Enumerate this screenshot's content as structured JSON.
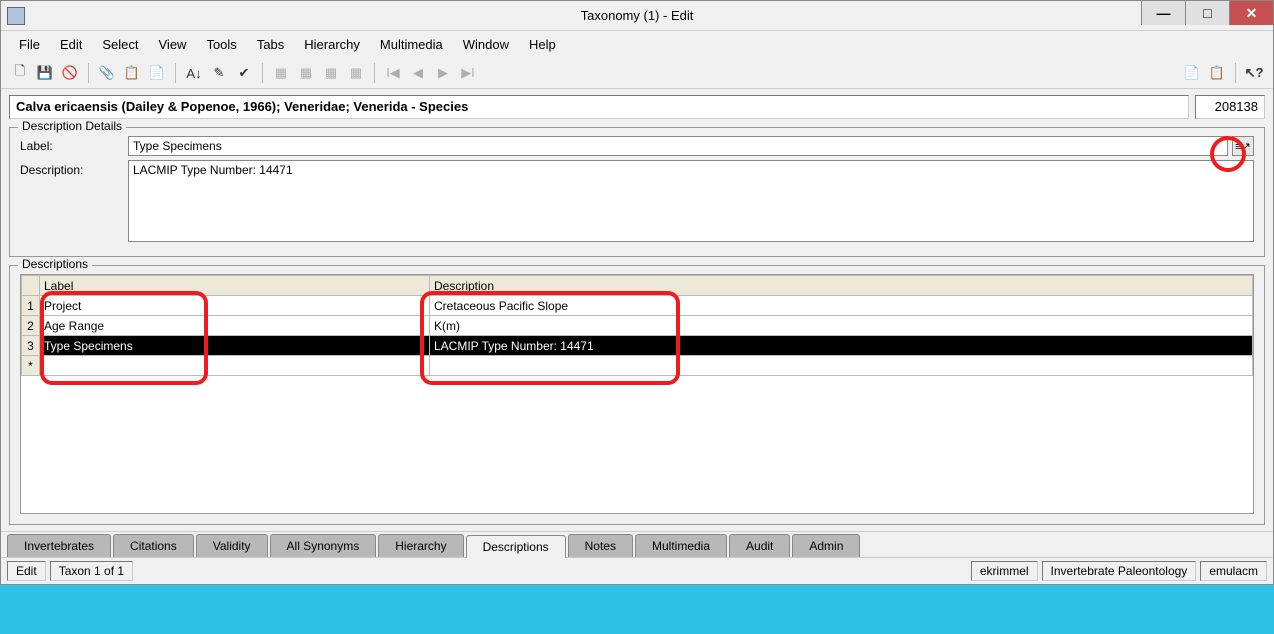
{
  "window": {
    "title": "Taxonomy (1) - Edit"
  },
  "menu": {
    "file": "File",
    "edit": "Edit",
    "select": "Select",
    "view": "View",
    "tools": "Tools",
    "tabs": "Tabs",
    "hierarchy": "Hierarchy",
    "multimedia": "Multimedia",
    "window": "Window",
    "help": "Help"
  },
  "breadcrumb": "Calva ericaensis (Dailey & Popenoe, 1966); Veneridae; Venerida - Species",
  "record_id": "208138",
  "details": {
    "legend": "Description Details",
    "label_label": "Label:",
    "description_label": "Description:",
    "label_value": "Type Specimens",
    "description_value": "LACMIP Type Number: 14471"
  },
  "grid": {
    "legend": "Descriptions",
    "headers": {
      "label": "Label",
      "description": "Description"
    },
    "rows": [
      {
        "n": "1",
        "label": "Project",
        "description": "Cretaceous Pacific Slope"
      },
      {
        "n": "2",
        "label": "Age Range",
        "description": "K(m)"
      },
      {
        "n": "3",
        "label": "Type Specimens",
        "description": "LACMIP Type Number: 14471"
      }
    ],
    "new_row_marker": "*"
  },
  "tabs": [
    "Invertebrates",
    "Citations",
    "Validity",
    "All Synonyms",
    "Hierarchy",
    "Descriptions",
    "Notes",
    "Multimedia",
    "Audit",
    "Admin"
  ],
  "active_tab": "Descriptions",
  "status": {
    "mode": "Edit",
    "record": "Taxon 1 of 1",
    "user": "ekrimmel",
    "dept": "Invertebrate Paleontology",
    "host": "emulacm"
  }
}
